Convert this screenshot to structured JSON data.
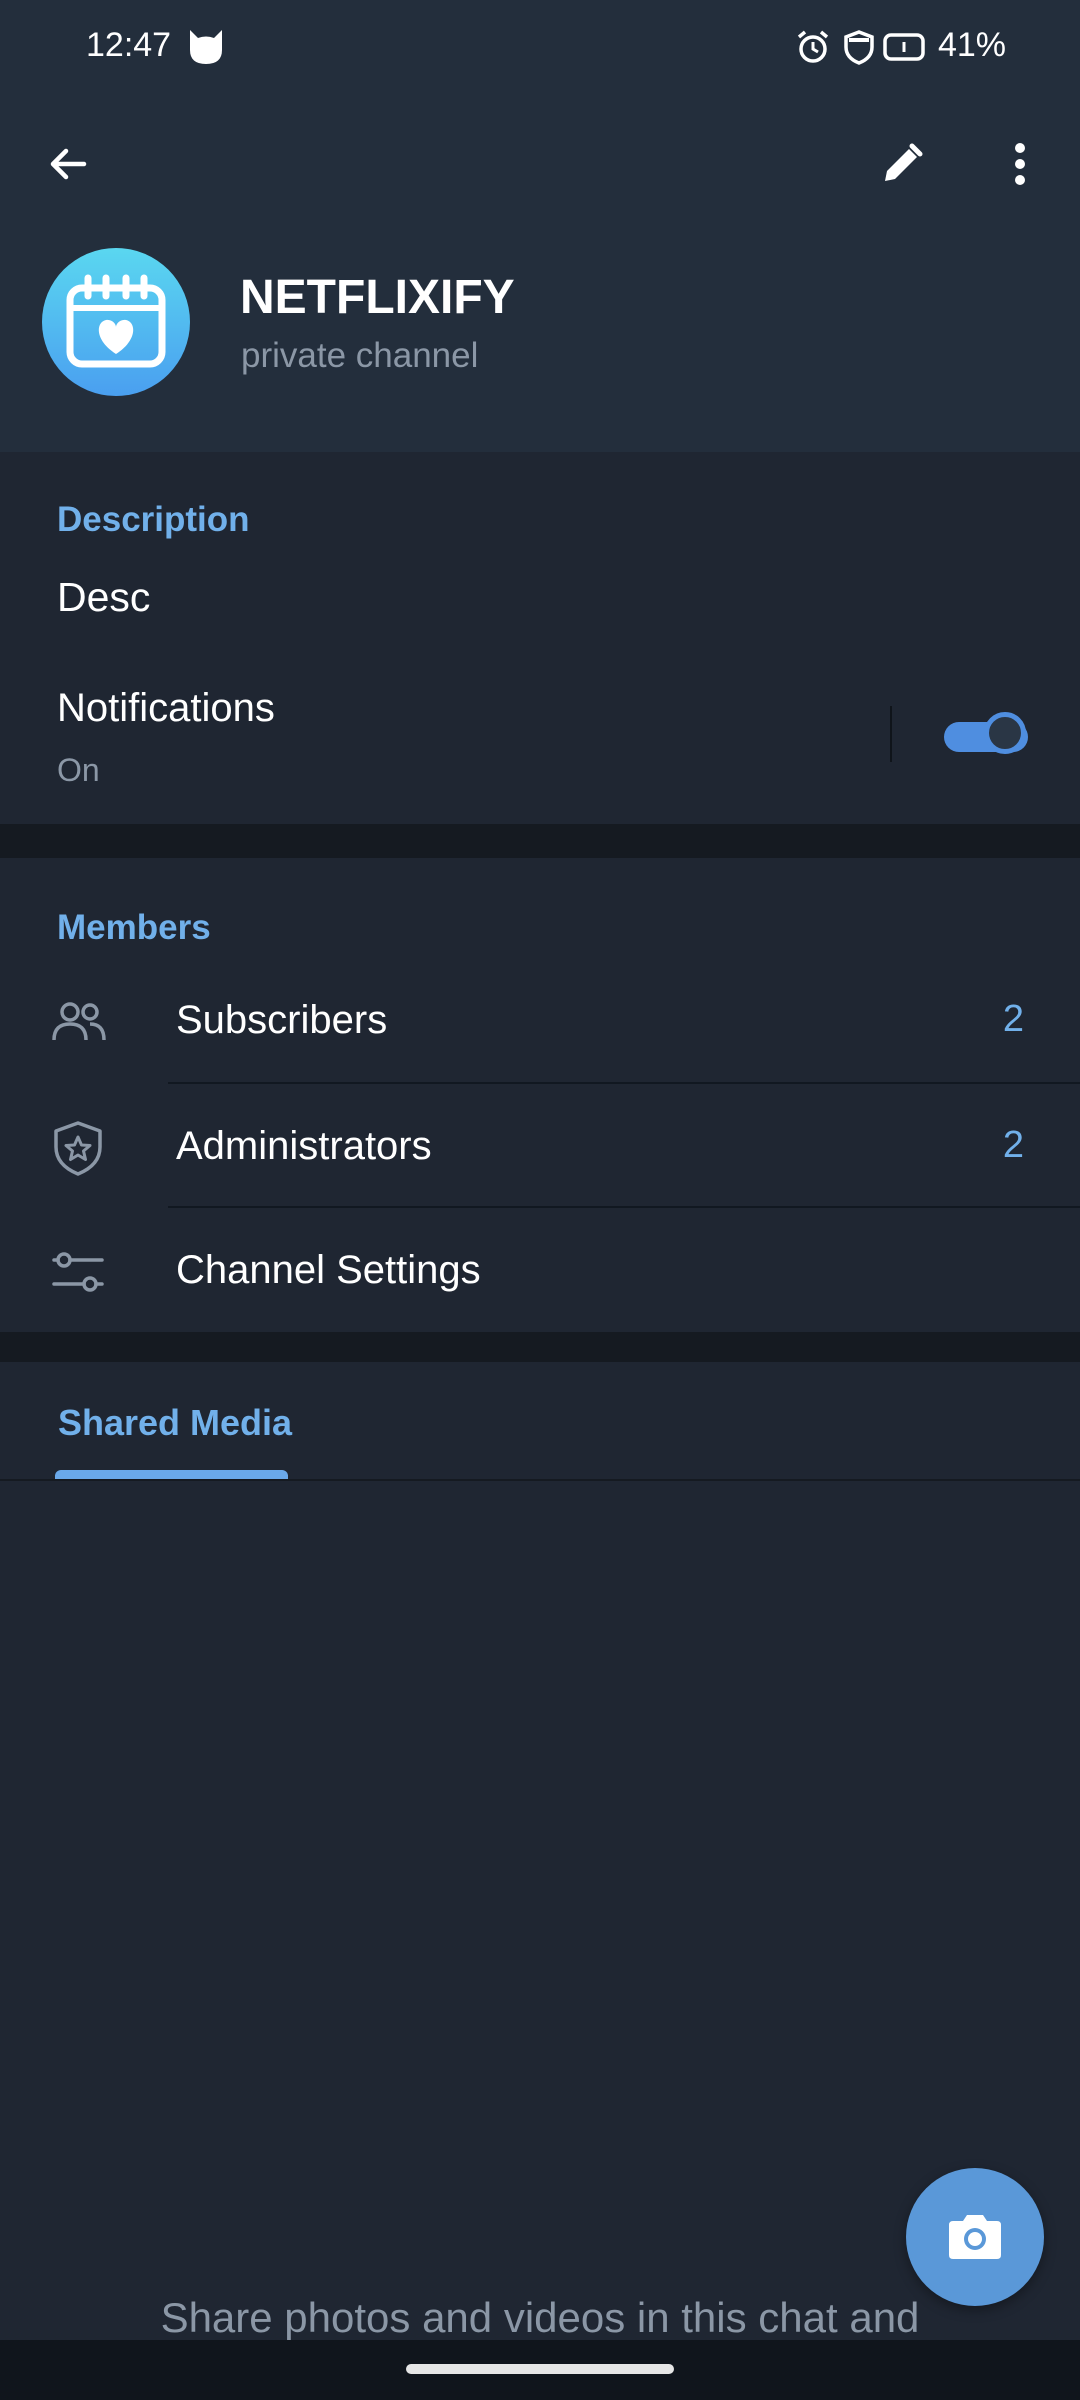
{
  "status_bar": {
    "time": "12:47",
    "battery": "41%"
  },
  "toolbar": {
    "back_icon": "arrow-left-icon",
    "edit_icon": "pencil-icon",
    "more_icon": "more-vertical-icon"
  },
  "channel": {
    "name": "NETFLIXIFY",
    "subtitle": "private channel",
    "avatar_icon": "calendar-heart-icon"
  },
  "info": {
    "description_title": "Description",
    "description_text": "Desc",
    "notifications_label": "Notifications",
    "notifications_state": "On",
    "notifications_enabled": true
  },
  "members": {
    "title": "Members",
    "items": [
      {
        "label": "Subscribers",
        "count": "2",
        "icon": "people-icon"
      },
      {
        "label": "Administrators",
        "count": "2",
        "icon": "shield-star-icon"
      },
      {
        "label": "Channel Settings",
        "count": "",
        "icon": "sliders-icon"
      }
    ]
  },
  "media": {
    "tab_label": "Shared Media",
    "empty_text": "Share photos and videos in this chat and"
  },
  "fab": {
    "icon": "camera-icon"
  },
  "colors": {
    "accent": "#71b0ea",
    "background": "#1f2632",
    "header": "#232e3c"
  }
}
